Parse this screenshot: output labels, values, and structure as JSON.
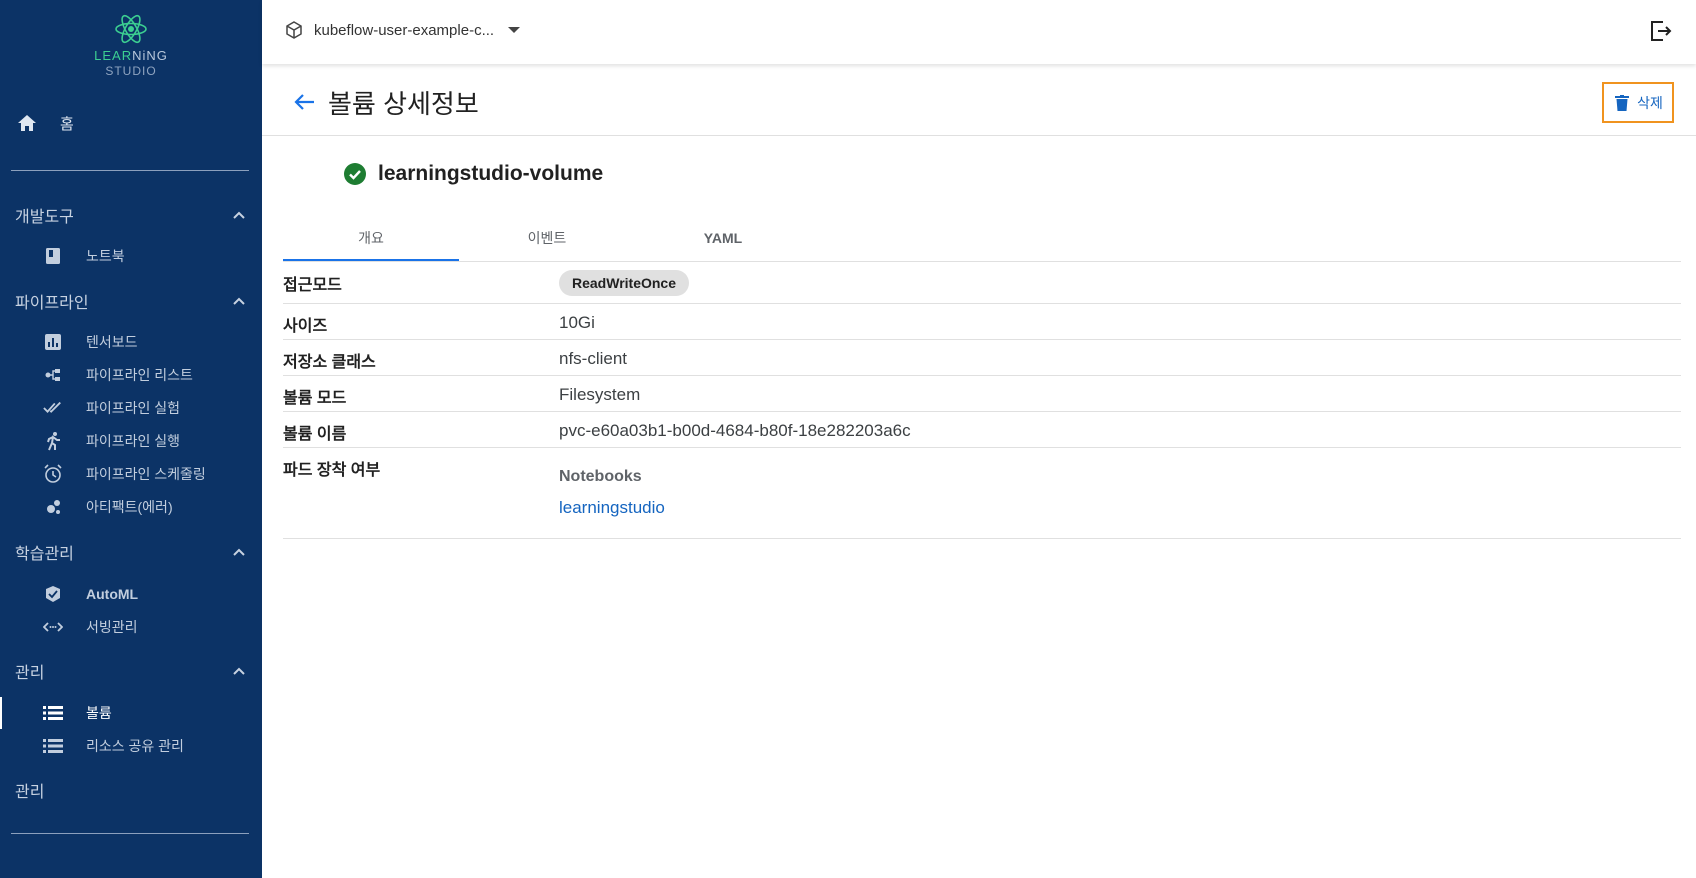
{
  "logo": {
    "line1_green": "LEAR",
    "line1_rest": "NiNG",
    "line2": "STUDIO"
  },
  "sidebar": {
    "home_label": "홈",
    "sections": [
      {
        "label": "개발도구",
        "items": [
          {
            "label": "노트북",
            "icon": "book-icon"
          }
        ]
      },
      {
        "label": "파이프라인",
        "items": [
          {
            "label": "텐서보드",
            "icon": "chart-icon"
          },
          {
            "label": "파이프라인 리스트",
            "icon": "pipeline-icon"
          },
          {
            "label": "파이프라인 실험",
            "icon": "double-check-icon"
          },
          {
            "label": "파이프라인 실행",
            "icon": "run-icon"
          },
          {
            "label": "파이프라인 스케줄링",
            "icon": "alarm-icon"
          },
          {
            "label": "아티팩트(에러)",
            "icon": "bubbles-icon"
          }
        ]
      },
      {
        "label": "학습관리",
        "items": [
          {
            "label": "AutoML",
            "icon": "automl-icon"
          },
          {
            "label": "서빙관리",
            "icon": "code-arrows-icon"
          }
        ]
      },
      {
        "label": "관리",
        "items": [
          {
            "label": "볼륨",
            "icon": "list-icon",
            "active": true
          },
          {
            "label": "리소스 공유 관리",
            "icon": "list-icon"
          }
        ]
      }
    ],
    "footer_section": "관리"
  },
  "topbar": {
    "namespace": "kubeflow-user-example-c...",
    "logout_icon": "logout-icon"
  },
  "header": {
    "title": "볼륨 상세정보",
    "delete_label": "삭제"
  },
  "volume": {
    "name": "learningstudio-volume",
    "status": "ready"
  },
  "tabs": [
    "개요",
    "이벤트",
    "YAML"
  ],
  "details": {
    "access_mode_label": "접근모드",
    "access_mode": "ReadWriteOnce",
    "size_label": "사이즈",
    "size": "10Gi",
    "storage_class_label": "저장소 클래스",
    "storage_class": "nfs-client",
    "volume_mode_label": "볼륨 모드",
    "volume_mode": "Filesystem",
    "volume_name_label": "볼륨 이름",
    "volume_name": "pvc-e60a03b1-b00d-4684-b80f-18e282203a6c",
    "pod_mount_label": "파드 장착 여부",
    "notebooks_heading": "Notebooks",
    "notebook_link": "learningstudio"
  },
  "colors": {
    "sidebar_bg": "#0c3366",
    "accent": "#1a73e8",
    "link": "#1565c0",
    "success": "#2e7d32",
    "focus": "#f0931f"
  }
}
